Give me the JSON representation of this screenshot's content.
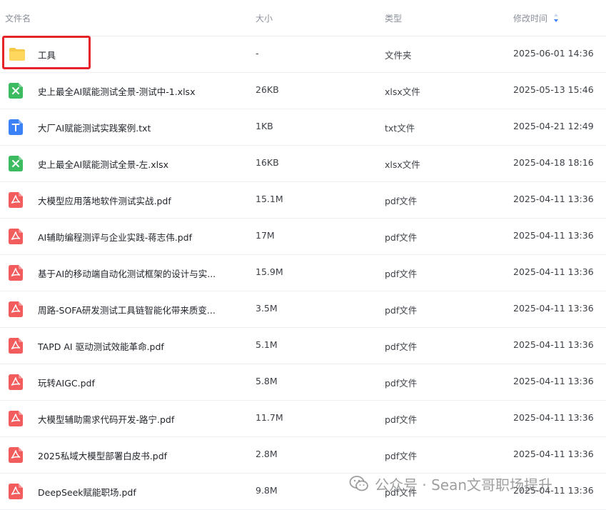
{
  "header": {
    "name": "文件名",
    "size": "大小",
    "type": "类型",
    "modified": "修改时间"
  },
  "rows": [
    {
      "icon": "folder-icon",
      "name": "工具",
      "size": "-",
      "type": "文件夹",
      "time": "2025-06-01 14:36"
    },
    {
      "icon": "excel-file-icon",
      "name": "史上最全AI赋能测试全景-测试中-1.xlsx",
      "size": "26KB",
      "type": "xlsx文件",
      "time": "2025-05-13 15:46"
    },
    {
      "icon": "text-file-icon",
      "name": "大厂AI赋能测试实践案例.txt",
      "size": "1KB",
      "type": "txt文件",
      "time": "2025-04-21 12:49"
    },
    {
      "icon": "excel-file-icon",
      "name": "史上最全AI赋能测试全景-左.xlsx",
      "size": "16KB",
      "type": "xlsx文件",
      "time": "2025-04-18 18:16"
    },
    {
      "icon": "pdf-file-icon",
      "name": "大模型应用落地软件测试实战.pdf",
      "size": "15.1M",
      "type": "pdf文件",
      "time": "2025-04-11 13:36"
    },
    {
      "icon": "pdf-file-icon",
      "name": "AI辅助编程测评与企业实践-蒋志伟.pdf",
      "size": "17M",
      "type": "pdf文件",
      "time": "2025-04-11 13:36"
    },
    {
      "icon": "pdf-file-icon",
      "name": "基于AI的移动端自动化测试框架的设计与实...",
      "size": "15.9M",
      "type": "pdf文件",
      "time": "2025-04-11 13:36"
    },
    {
      "icon": "pdf-file-icon",
      "name": "周路-SOFA研发测试工具链智能化带来质变...",
      "size": "3.5M",
      "type": "pdf文件",
      "time": "2025-04-11 13:36"
    },
    {
      "icon": "pdf-file-icon",
      "name": "TAPD AI 驱动测试效能革命.pdf",
      "size": "5.1M",
      "type": "pdf文件",
      "time": "2025-04-11 13:36"
    },
    {
      "icon": "pdf-file-icon",
      "name": "玩转AIGC.pdf",
      "size": "5.8M",
      "type": "pdf文件",
      "time": "2025-04-11 13:36"
    },
    {
      "icon": "pdf-file-icon",
      "name": "大模型辅助需求代码开发-路宁.pdf",
      "size": "11.7M",
      "type": "pdf文件",
      "time": "2025-04-11 13:36"
    },
    {
      "icon": "pdf-file-icon",
      "name": "2025私域大模型部署白皮书.pdf",
      "size": "2.8M",
      "type": "pdf文件",
      "time": "2025-04-11 13:36"
    },
    {
      "icon": "pdf-file-icon",
      "name": "DeepSeek赋能职场.pdf",
      "size": "9.8M",
      "type": "pdf文件",
      "time": "2025-04-11 13:36"
    }
  ],
  "watermark": {
    "text": "公众号 · Sean文哥职场提升"
  },
  "colors": {
    "folder": "#f7c948",
    "excel": "#3dbb61",
    "text": "#3b82f6",
    "pdf": "#f25c5c",
    "highlight": "#e6232a",
    "sort": "#3b82f6"
  }
}
